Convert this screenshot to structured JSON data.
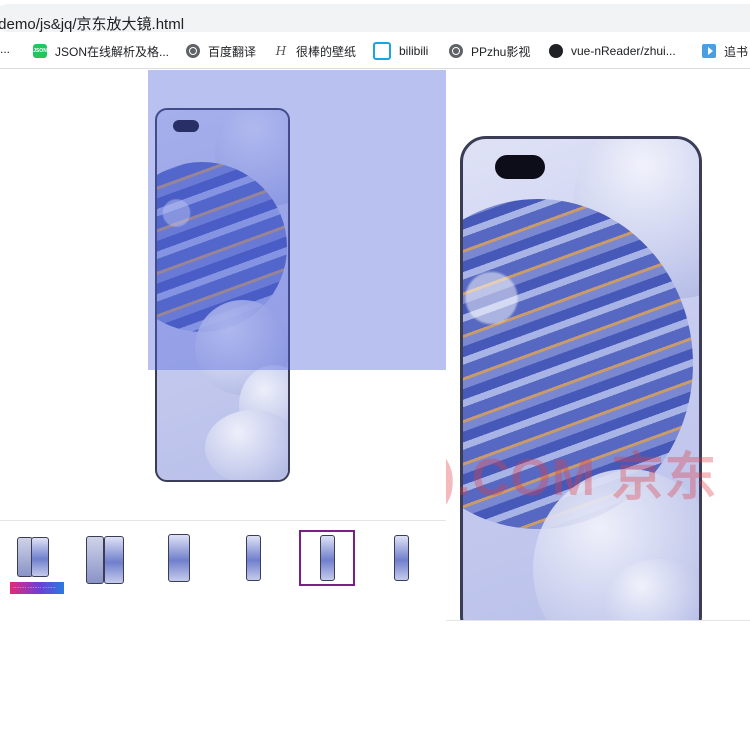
{
  "browser": {
    "url": "/demo/js&jq/京东放大镜.html"
  },
  "bookmarks": {
    "overflow": "...",
    "items": [
      {
        "label": "JSON在线解析及格...",
        "icon": "json-icon",
        "badge": "JSON"
      },
      {
        "label": "百度翻译",
        "icon": "globe-icon"
      },
      {
        "label": "很棒的壁纸",
        "icon": "h-logo-icon",
        "glyph": "H"
      },
      {
        "label": "bilibili",
        "icon": "bilibili-icon"
      },
      {
        "label": "PPzhu影视",
        "icon": "globe-icon"
      },
      {
        "label": "vue-nReader/zhui...",
        "icon": "github-icon"
      },
      {
        "label": "追书",
        "icon": "book-icon"
      }
    ]
  },
  "product": {
    "thumbnail_promo_text": "········ ········ ········",
    "thumbnails": [
      {
        "kind": "phone-pair",
        "active": false
      },
      {
        "kind": "phone-pair",
        "active": false
      },
      {
        "kind": "phone-single",
        "active": false
      },
      {
        "kind": "phone-single",
        "active": false
      },
      {
        "kind": "phone-single",
        "active": true
      },
      {
        "kind": "phone-single",
        "active": false
      }
    ],
    "active_thumbnail_index": 4
  },
  "zoom_panel": {
    "watermark": ").COM 京东"
  },
  "colors": {
    "lens_overlay": "#5064dc",
    "active_thumb_border": "#7a1f86",
    "watermark": "#dc3c46"
  }
}
